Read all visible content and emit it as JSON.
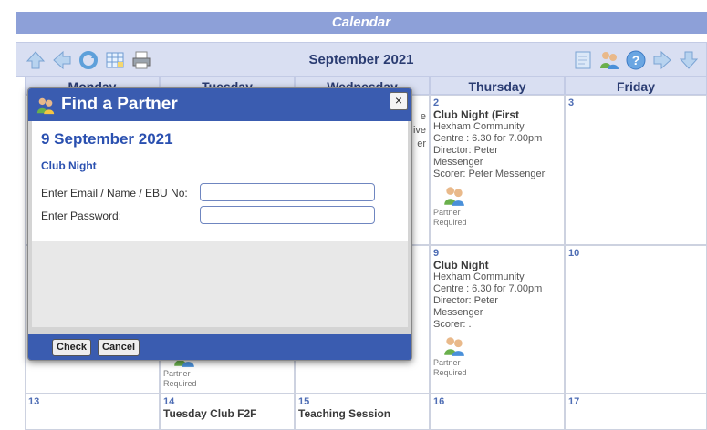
{
  "header": {
    "title": "Calendar"
  },
  "toolbar": {
    "month": "September 2021"
  },
  "days": [
    "Monday",
    "Tuesday",
    "Wednesday",
    "Thursday",
    "Friday"
  ],
  "cells": {
    "thu2": {
      "num": "2",
      "event": "Club Night (First",
      "lines": [
        "Hexham Community",
        "Centre : 6.30 for 7.00pm",
        "Director: Peter",
        "Messenger",
        "Scorer: Peter Messenger"
      ],
      "partner": [
        "Partner",
        "Required"
      ]
    },
    "fri3": {
      "num": "3"
    },
    "thu9": {
      "num": "9",
      "event": "Club Night",
      "lines": [
        "Hexham Community",
        "Centre : 6.30 for 7.00pm",
        "Director: Peter",
        "Messenger",
        "Scorer: ."
      ],
      "partner": [
        "Partner",
        "Required"
      ]
    },
    "fri10": {
      "num": "10"
    },
    "tue7_partner": [
      "Partner",
      "Required"
    ],
    "mon13": {
      "num": "13"
    },
    "tue14": {
      "num": "14",
      "event": "Tuesday Club F2F"
    },
    "wed15": {
      "num": "15",
      "event": "Teaching Session"
    },
    "thu16": {
      "num": "16"
    },
    "fri17": {
      "num": "17"
    },
    "wed_partial": [
      "e",
      "",
      "",
      "ive",
      "er"
    ]
  },
  "modal": {
    "title": "Find a Partner",
    "date": "9 September 2021",
    "event": "Club Night",
    "email_label": "Enter Email / Name / EBU No:",
    "password_label": "Enter Password:",
    "check_label": "Check",
    "cancel_label": "Cancel",
    "close_glyph": "×"
  },
  "icons": {
    "left": [
      "up-arrow-icon",
      "left-arrow-icon",
      "refresh-icon",
      "calendar-grid-icon",
      "printer-icon"
    ],
    "right": [
      "notepad-icon",
      "users-icon",
      "help-icon",
      "right-arrow-icon",
      "down-arrow-icon"
    ]
  }
}
